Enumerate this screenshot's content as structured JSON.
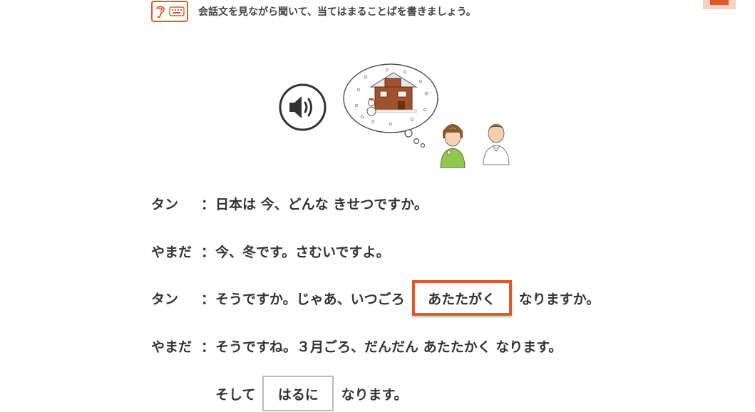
{
  "instruction": {
    "text": "会話文を見ながら聞いて、当てはまることばを書きましょう。",
    "icons": [
      "ear-icon",
      "keyboard-icon"
    ],
    "accent": "#e0592c"
  },
  "audio": {
    "icon": "speaker-icon"
  },
  "dialogue": [
    {
      "speaker": "タン",
      "parts": [
        {
          "text": "日本は 今、どんな きせつですか。"
        }
      ]
    },
    {
      "speaker": "やまだ",
      "parts": [
        {
          "text": "今、冬です。さむいですよ。"
        }
      ]
    },
    {
      "speaker": "タン",
      "parts": [
        {
          "text": "そうですか。じゃあ、いつごろ"
        },
        {
          "answer": "あたたがく"
        },
        {
          "text": "なりますか。"
        }
      ]
    },
    {
      "speaker": "やまだ",
      "parts": [
        {
          "text": "そうですね。３月ごろ、だんだん あたたかく なります。"
        }
      ]
    },
    {
      "speaker": "",
      "parts": [
        {
          "text": "そして"
        },
        {
          "answer": "はるに"
        },
        {
          "text": "なります。"
        }
      ]
    }
  ],
  "colon": "："
}
